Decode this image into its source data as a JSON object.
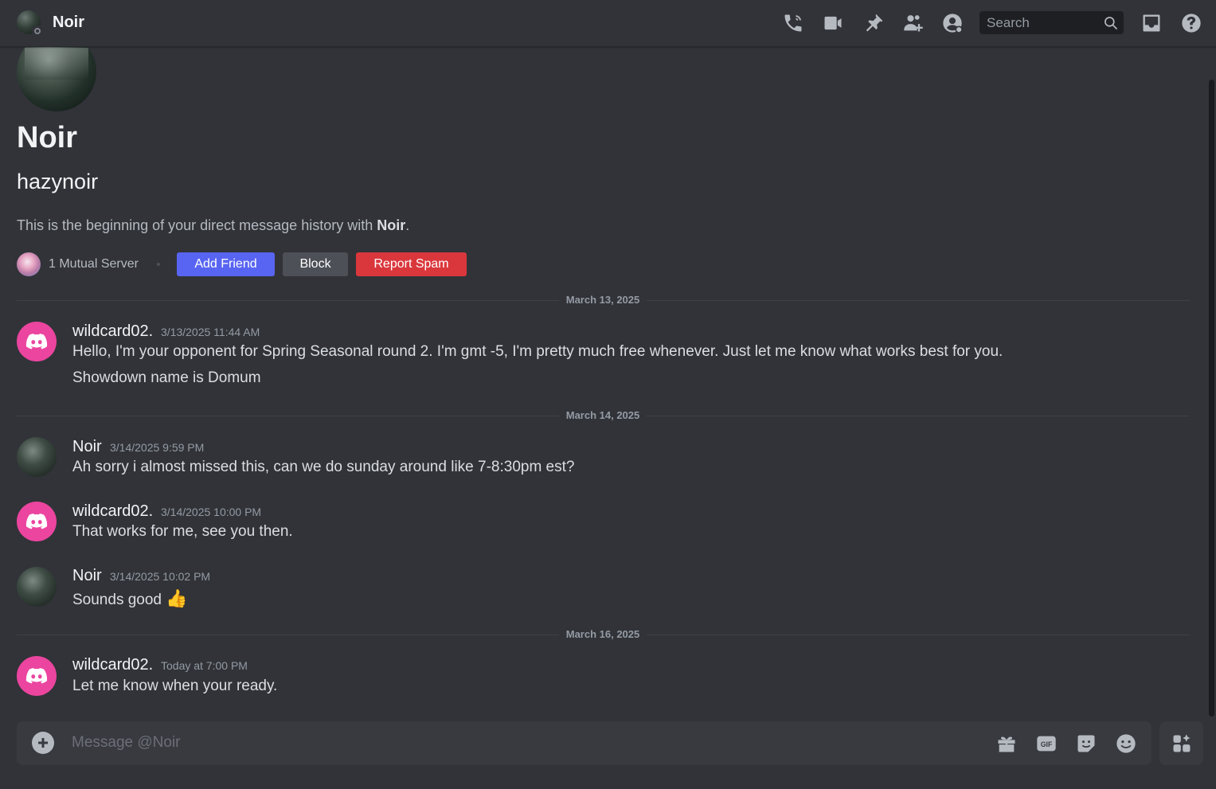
{
  "header": {
    "title": "Noir",
    "search_placeholder": "Search",
    "icons": [
      "phone-call-icon",
      "video-call-icon",
      "pin-icon",
      "add-member-icon",
      "user-profile-icon",
      "search-icon",
      "inbox-icon",
      "help-icon"
    ]
  },
  "intro": {
    "display_name": "Noir",
    "username": "hazynoir",
    "beginning_text": "This is the beginning of your direct message history with ",
    "beginning_name": "Noir",
    "beginning_end": ".",
    "mutual_servers": "1 Mutual Server",
    "buttons": {
      "add_friend": "Add Friend",
      "block": "Block",
      "report_spam": "Report Spam"
    }
  },
  "dividers": [
    "March 13, 2025",
    "March 14, 2025",
    "March 16, 2025"
  ],
  "messages": [
    {
      "author": "wildcard02.",
      "time": "3/13/2025 11:44 AM",
      "lines": [
        "Hello, I'm your opponent for Spring Seasonal round 2. I'm gmt -5, I'm pretty much free whenever. Just let me know what works best for you.",
        "Showdown name is Domum"
      ]
    },
    {
      "author": "Noir",
      "time": "3/14/2025 9:59 PM",
      "lines": [
        "Ah sorry i almost missed this, can we do sunday around like 7-8:30pm est?"
      ]
    },
    {
      "author": "wildcard02.",
      "time": "3/14/2025 10:00 PM",
      "lines": [
        "That works for me, see you then."
      ]
    },
    {
      "author": "Noir",
      "time": "3/14/2025 10:02 PM",
      "lines": [
        "Sounds good"
      ],
      "emoji": "👍"
    },
    {
      "author": "wildcard02.",
      "time": "Today at 7:00 PM",
      "lines": [
        "Let me know when your ready."
      ]
    }
  ],
  "composer": {
    "placeholder": "Message @Noir",
    "icons": [
      "add-attachment-icon",
      "gift-icon",
      "gif-icon",
      "sticker-icon",
      "emoji-icon",
      "apps-icon"
    ]
  }
}
